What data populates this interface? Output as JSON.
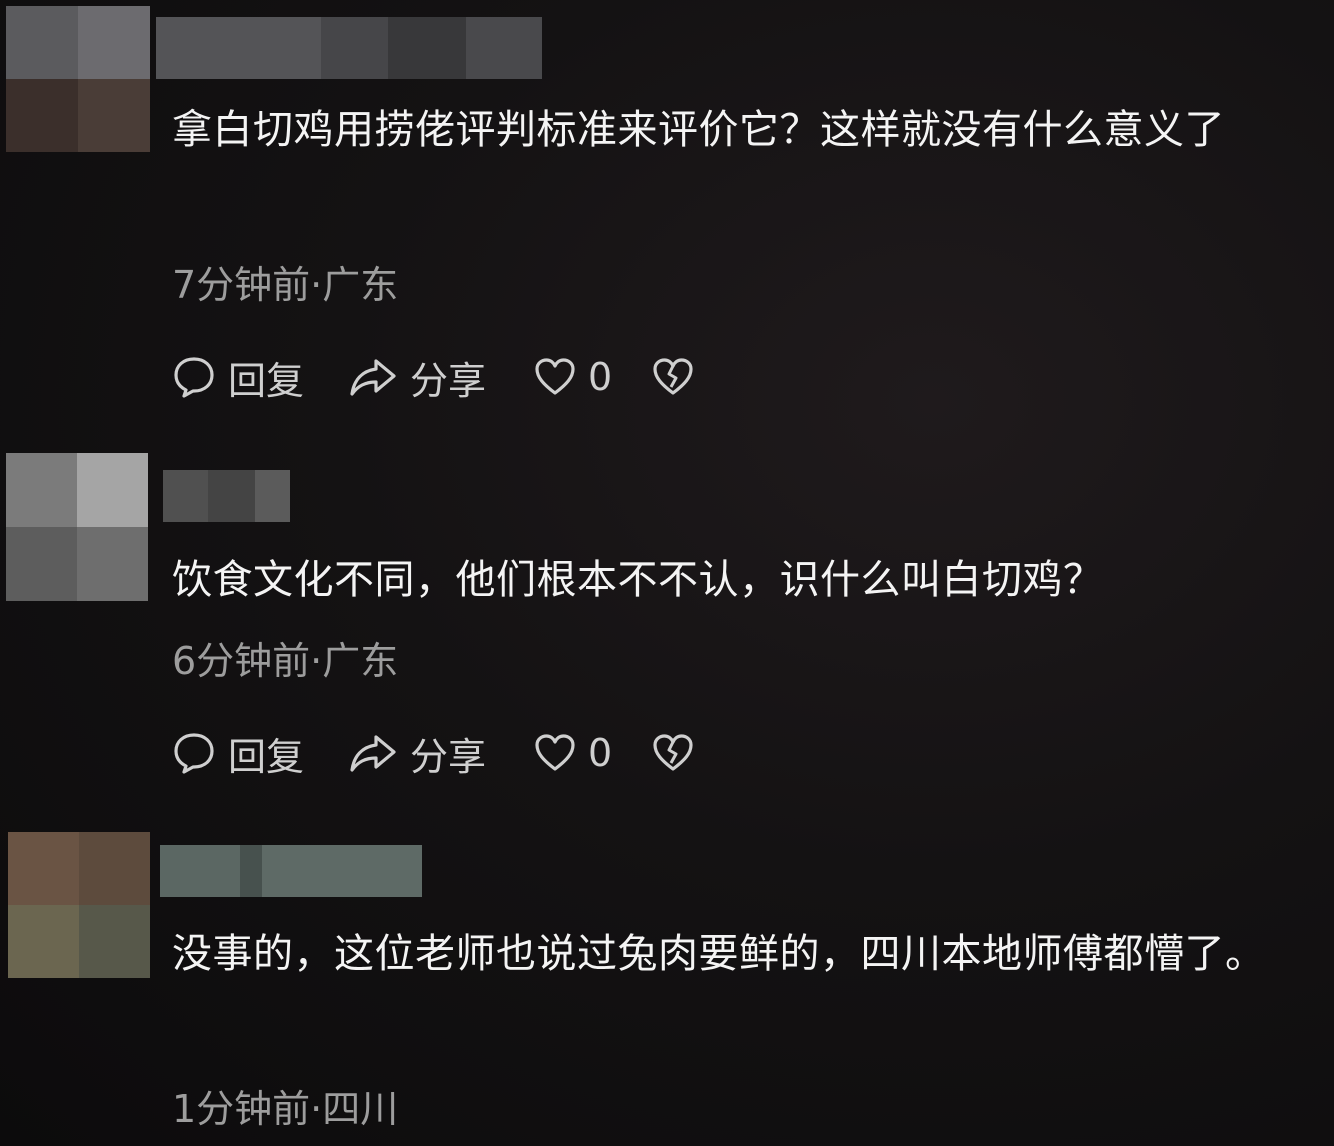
{
  "comments": [
    {
      "text": "拿白切鸡用捞佬评判标准来评价它？这样就没有什么意义了",
      "meta": "7分钟前·广东",
      "reply_label": "回复",
      "share_label": "分享",
      "like_count": "0"
    },
    {
      "text": "饮食文化不同，他们根本不不认，识什么叫白切鸡？",
      "meta": "6分钟前·广东",
      "reply_label": "回复",
      "share_label": "分享",
      "like_count": "0"
    },
    {
      "text": "没事的，这位老师也说过兔肉要鲜的，四川本地师傅都懵了。",
      "meta": "1分钟前·四川"
    }
  ],
  "icons": {
    "reply": "speech-bubble-icon",
    "share": "share-arrow-icon",
    "like": "heart-icon",
    "dislike": "broken-heart-icon"
  },
  "colors": {
    "background": "#141213",
    "text": "#f4f4f4",
    "meta": "#9d9d9d",
    "action": "#cfcfcf"
  }
}
